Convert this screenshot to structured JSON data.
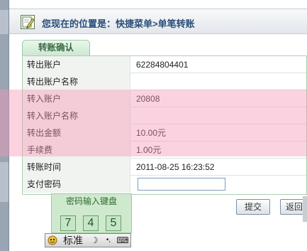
{
  "breadcrumb": "您现在的位置是：快捷菜单>单笔转账",
  "tab_label": "转账确认",
  "rows": [
    {
      "label": "转出账户",
      "value": "62284804401"
    },
    {
      "label": "转出账户名称",
      "value": ""
    },
    {
      "label": "转入账户",
      "value": "                 20808"
    },
    {
      "label": "转入账户名称",
      "value": ""
    },
    {
      "label": "转出金额",
      "value": "10.00元"
    },
    {
      "label": "手续费",
      "value": "1.00元"
    },
    {
      "label": "转账时间",
      "value": "2011-08-25 16:23:52"
    },
    {
      "label": "支付密码",
      "value": ""
    }
  ],
  "buttons": {
    "submit": "提交",
    "back": "返回"
  },
  "keyboard": {
    "title": "密码输入键盘",
    "keys": [
      "7",
      "4",
      "5"
    ]
  },
  "ime": {
    "mode": "标准",
    "icons": [
      "ime-logo-icon",
      "moon-icon",
      "dots-icon",
      "soft-keyboard-icon"
    ]
  },
  "colors": {
    "overlay": "#f696b6",
    "tab_green": "#3a6b44",
    "title_blue": "#2a4e7a"
  }
}
